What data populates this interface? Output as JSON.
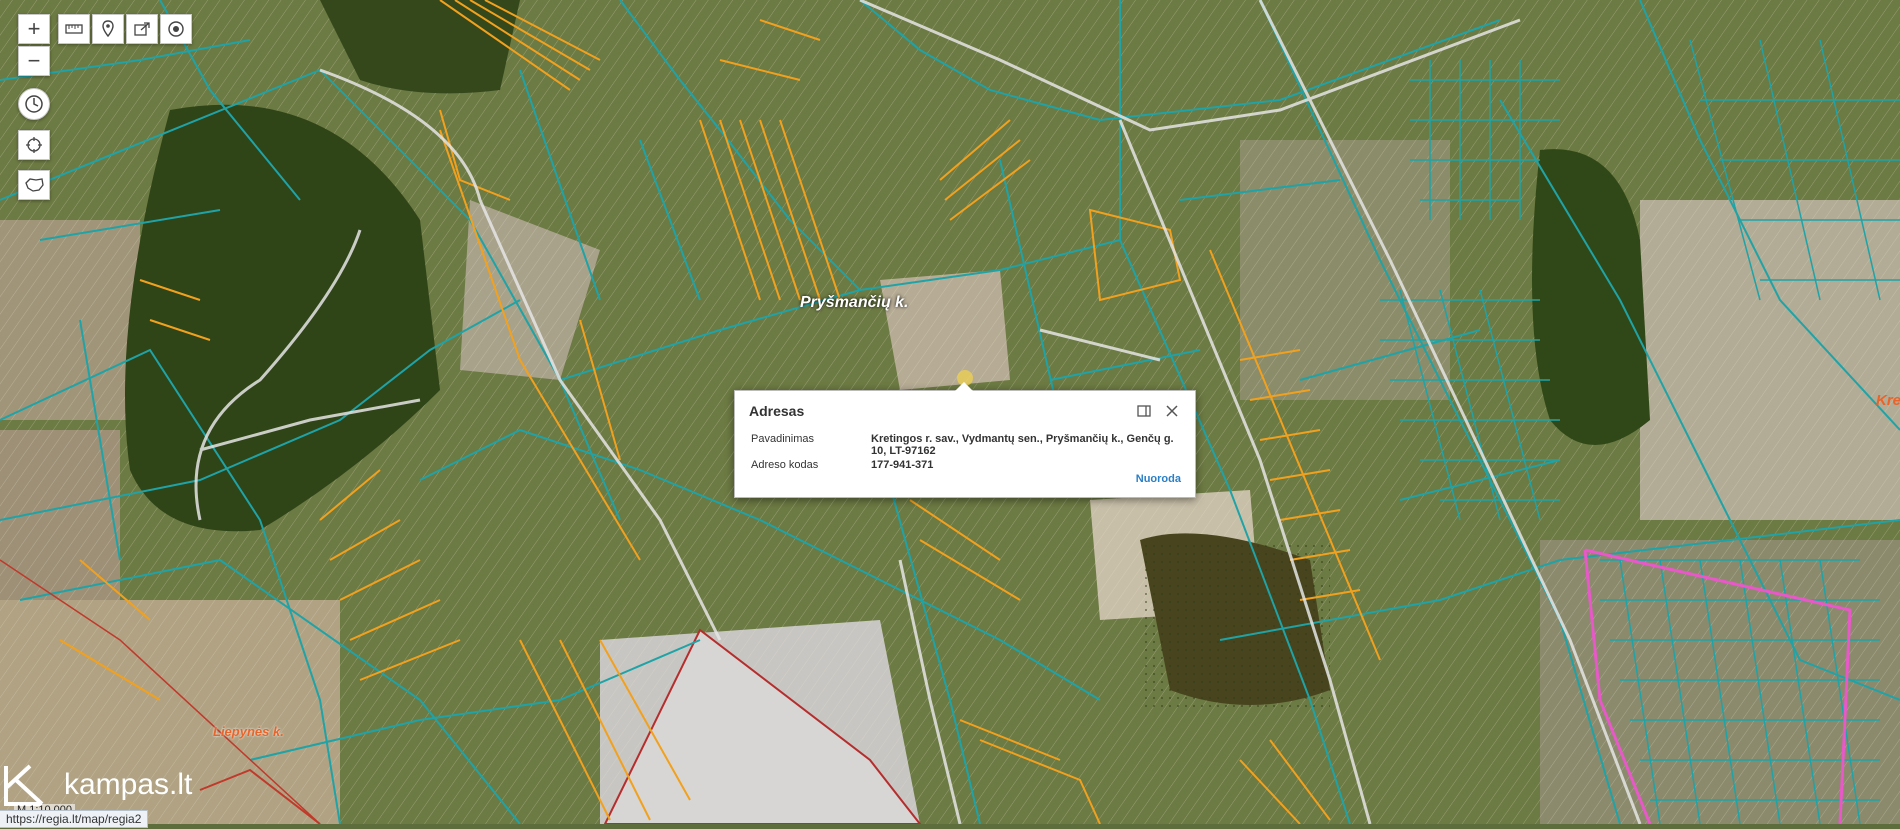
{
  "controls": {
    "zoom_in": "+",
    "zoom_out": "−"
  },
  "labels": {
    "village_prysmanciu": "Pryšmančių k.",
    "village_liepynes": "Liepynės k.",
    "edge_kre": "Kre"
  },
  "popup": {
    "title": "Adresas",
    "rows": [
      {
        "label": "Pavadinimas",
        "value": "Kretingos r. sav., Vydmantų sen., Pryšmančių k., Genčų g. 10, LT-97162"
      },
      {
        "label": "Adreso kodas",
        "value": "177-941-371"
      }
    ],
    "link": "Nuoroda"
  },
  "logo": {
    "text": "kampas.lt"
  },
  "scale": {
    "text": "M 1:10 000"
  },
  "status_url": "https://regia.lt/map/regia2",
  "colors": {
    "parcel": "#1fa3a7",
    "parcel_alt": "#f2a11e",
    "road": "#d6d6d6",
    "boundary_pink": "#e858c8",
    "boundary_red": "#c0392b",
    "link": "#2a7fc6"
  }
}
